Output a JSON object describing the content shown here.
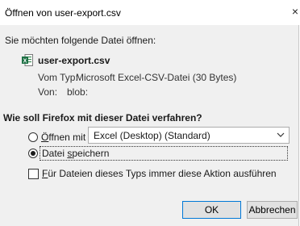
{
  "window": {
    "title": "Öffnen von user-export.csv",
    "close_glyph": "×"
  },
  "dialog": {
    "intro": "Sie möchten folgende Datei öffnen:",
    "file_icon": "excel-csv-file-icon",
    "file_name": "user-export.csv",
    "type_label": "Vom Typ:",
    "type_value": "Microsoft Excel-CSV-Datei (30 Bytes)",
    "from_label": "Von:",
    "from_value": "blob:",
    "question": "Wie soll Firefox mit dieser Datei verfahren?",
    "open_with": {
      "label_first": "Ö",
      "label_rest": "ffnen mit",
      "selected_app": "Excel (Desktop) (Standard)",
      "checked": false
    },
    "save_file": {
      "label_first": "Datei ",
      "label_underlined": "s",
      "label_rest": "peichern",
      "checked": true
    },
    "always_action": {
      "label_first": "F",
      "label_rest": "ür Dateien dieses Typs immer diese Aktion ausführen",
      "checked": false
    },
    "buttons": {
      "ok": "OK",
      "cancel": "Abbrechen"
    }
  }
}
